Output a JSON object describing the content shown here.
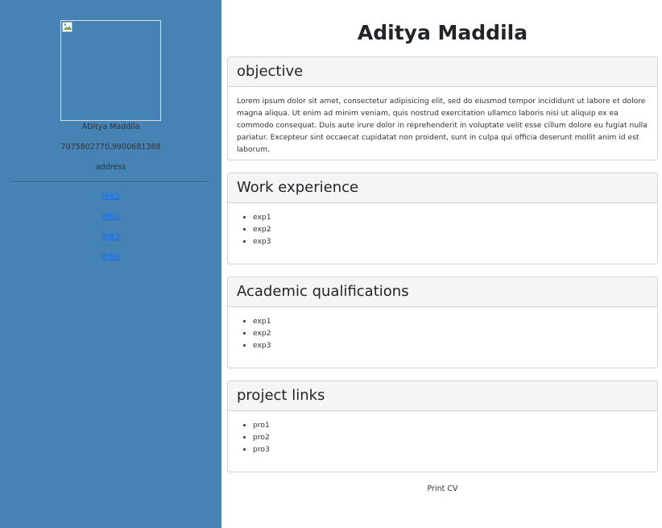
{
  "sidebar": {
    "name": "ADitya Maddila",
    "phone": "7075802770,9900681388",
    "address": "address",
    "links": [
      "link1",
      "link2",
      "link3",
      "link4"
    ],
    "photo_icon": "broken-image-icon"
  },
  "header": {
    "title": "Aditya Maddila"
  },
  "sections": {
    "objective": {
      "title": "objective",
      "text": "Lorem ipsum dolor sit amet, consectetur adipisicing elit, sed do eiusmod tempor incididunt ut labore et dolore magna aliqua. Ut enim ad minim veniam, quis nostrud exercitation ullamco laboris nisi ut aliquip ex ea commodo consequat. Duis aute irure dolor in reprehenderit in voluptate velit esse cillum dolore eu fugiat nulla pariatur. Excepteur sint occaecat cupidatat non proident, sunt in culpa qui officia deserunt mollit anim id est laborum."
    },
    "work": {
      "title": "Work experience",
      "items": [
        "exp1",
        "exp2",
        "exp3"
      ]
    },
    "academic": {
      "title": "Academic qualifications",
      "items": [
        "exp1",
        "exp2",
        "exp3"
      ]
    },
    "projects": {
      "title": "project links",
      "items": [
        "pro1",
        "pro2",
        "pro3"
      ]
    }
  },
  "footer": {
    "print_label": "Print CV"
  },
  "colors": {
    "sidebar_bg": "#4682b4",
    "link": "#0d6efd",
    "card_header_bg": "#f5f5f5"
  }
}
